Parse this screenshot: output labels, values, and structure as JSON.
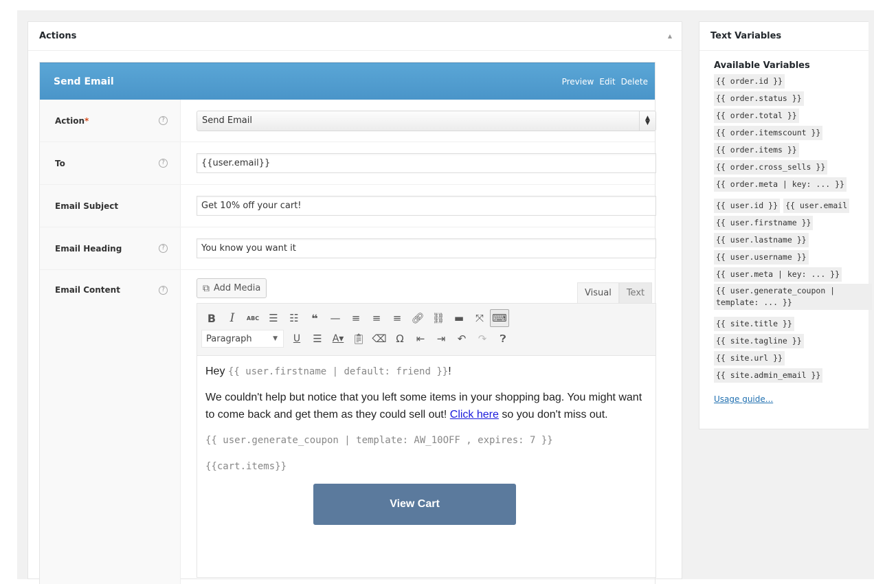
{
  "actions_panel": {
    "title": "Actions",
    "collapse_icon": "▲",
    "action": {
      "title": "Send Email",
      "links": [
        "Preview",
        "Edit",
        "Delete"
      ],
      "fields": [
        {
          "label": "Action",
          "required": "*",
          "has_help": true,
          "type": "select",
          "value": "Send Email"
        },
        {
          "label": "To",
          "has_help": true,
          "type": "text",
          "value": "{{user.email}}"
        },
        {
          "label": "Email Subject",
          "has_help": false,
          "type": "text",
          "value": "Get 10% off your cart!"
        },
        {
          "label": "Email Heading",
          "has_help": true,
          "type": "text",
          "value": "You know you want it"
        }
      ],
      "content": {
        "label": "Email Content",
        "add_media": "Add Media",
        "tabs": [
          "Visual",
          "Text"
        ],
        "active_tab": "Visual",
        "format_select": "Paragraph",
        "body": {
          "greeting_prefix": "Hey ",
          "greeting_var": "{{ user.firstname | default: friend }}",
          "greeting_suffix": "!",
          "para_1": "We couldn't help but notice that you left some items in your shopping bag. You might want to come back and get them as they could sell out! ",
          "link_text": "Click here",
          "para_1_end": " so you don't miss out.",
          "coupon_var": "{{ user.generate_coupon | template: AW_10OFF , expires: 7 }}",
          "cart_var": "{{cart.items}}",
          "button_label": "View Cart"
        }
      }
    }
  },
  "vars_panel": {
    "title": "Text Variables",
    "subtitle": "Available Variables",
    "order_vars": [
      "{{ order.id }}",
      "{{ order.status }}",
      "{{ order.total }}",
      "{{ order.itemscount }}",
      "{{ order.items }}",
      "{{ order.cross_sells }}",
      "{{ order.meta | key: ... }}"
    ],
    "user_vars_inline": [
      "{{ user.id }}",
      "{{ user.email"
    ],
    "user_vars": [
      "{{ user.firstname }}",
      "{{ user.lastname }}",
      "{{ user.username }}",
      "{{ user.meta | key: ... }}",
      "{{ user.generate_coupon | template: ... }}"
    ],
    "site_vars": [
      "{{ site.title }}",
      "{{ site.tagline }}",
      "{{ site.url }}",
      "{{ site.admin_email }}"
    ],
    "usage_link": "Usage guide..."
  },
  "colors": {
    "action_header": "#4a95c9",
    "view_cart_button": "#5b7a9d",
    "required": "#d54e21",
    "link": "#2271b1"
  }
}
